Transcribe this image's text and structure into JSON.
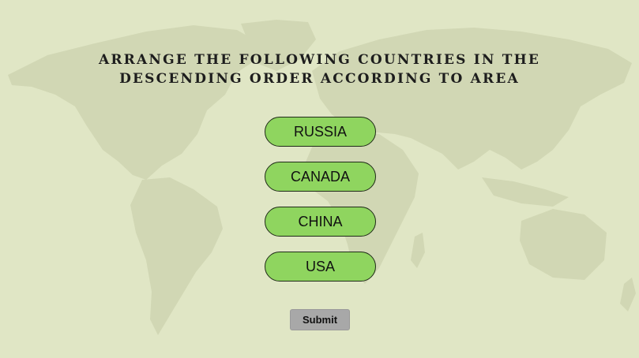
{
  "question": {
    "line1": "ARRANGE THE FOLLOWING COUNTRIES IN THE",
    "line2": "DESCENDING ORDER ACCORDING TO AREA"
  },
  "options": [
    "RUSSIA",
    "CANADA",
    "CHINA",
    "USA"
  ],
  "submit_label": "Submit",
  "colors": {
    "background": "#e0e6c5",
    "map": "#d1d7b4",
    "option_fill": "#8fd55f",
    "submit_fill": "#a8a8a8"
  }
}
